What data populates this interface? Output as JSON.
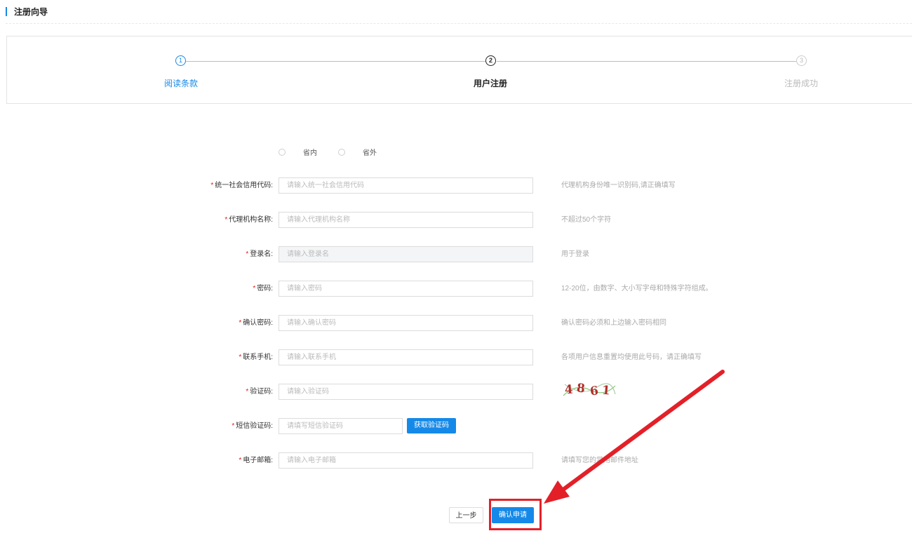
{
  "page": {
    "title": "注册向导"
  },
  "steps": [
    {
      "num": "1",
      "label": "阅读条款",
      "state": "done"
    },
    {
      "num": "2",
      "label": "用户注册",
      "state": "active"
    },
    {
      "num": "3",
      "label": "注册成功",
      "state": "pending"
    }
  ],
  "region": {
    "options": [
      "省内",
      "省外"
    ]
  },
  "form": {
    "credit_code": {
      "label": "统一社会信用代码",
      "placeholder": "请输入统一社会信用代码",
      "hint": "代理机构身份唯一识别码,请正确填写"
    },
    "agency_name": {
      "label": "代理机构名称",
      "placeholder": "请输入代理机构名称",
      "hint": "不超过50个字符"
    },
    "login_name": {
      "label": "登录名",
      "placeholder": "请输入登录名",
      "hint": "用于登录"
    },
    "password": {
      "label": "密码",
      "placeholder": "请输入密码",
      "hint": "12-20位，由数字、大小写字母和特殊字符组成。"
    },
    "confirm_password": {
      "label": "确认密码",
      "placeholder": "请输入确认密码",
      "hint": "确认密码必须和上边输入密码相同"
    },
    "phone": {
      "label": "联系手机",
      "placeholder": "请输入联系手机",
      "hint": "各项用户信息重置均使用此号码，请正确填写"
    },
    "captcha": {
      "label": "验证码",
      "placeholder": "请输入验证码",
      "image_text": "4861"
    },
    "sms_code": {
      "label": "短信验证码",
      "placeholder": "请填写短信验证码",
      "button": "获取验证码"
    },
    "email": {
      "label": "电子邮箱",
      "placeholder": "请输入电子邮箱",
      "hint": "请填写您的常用邮件地址"
    }
  },
  "actions": {
    "prev": "上一步",
    "submit": "确认申请"
  },
  "colors": {
    "primary": "#1589e8",
    "required": "#e02020",
    "annotation": "#e32028"
  }
}
